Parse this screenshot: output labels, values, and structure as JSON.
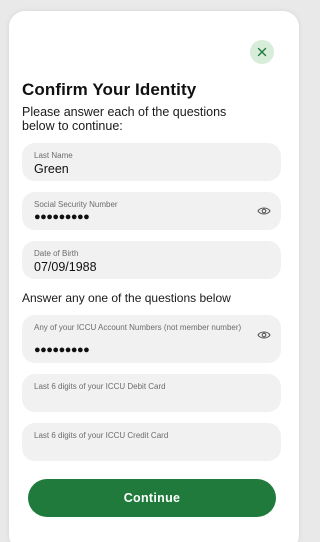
{
  "dialog": {
    "title": "Confirm Your Identity",
    "subtitle": "Please answer each of the questions below to continue:",
    "close_icon": "close-icon",
    "accent_color": "#1f7a3c"
  },
  "fields": {
    "last_name": {
      "label": "Last Name",
      "value": "Green"
    },
    "ssn": {
      "label": "Social Security Number",
      "value": "●●●●●●●●●",
      "icon": "eye-icon"
    },
    "dob": {
      "label": "Date of Birth",
      "value": "07/09/1988"
    }
  },
  "section_label": "Answer any one of the questions below",
  "optional_fields": {
    "account_numbers": {
      "label": "Any of your ICCU Account Numbers (not member number)",
      "value": "●●●●●●●●●",
      "icon": "eye-icon"
    },
    "debit_card": {
      "label": "Last 6 digits of your ICCU Debit Card",
      "value": ""
    },
    "credit_card": {
      "label": "Last 6 digits of your ICCU Credit Card",
      "value": ""
    }
  },
  "actions": {
    "continue_label": "Continue"
  }
}
